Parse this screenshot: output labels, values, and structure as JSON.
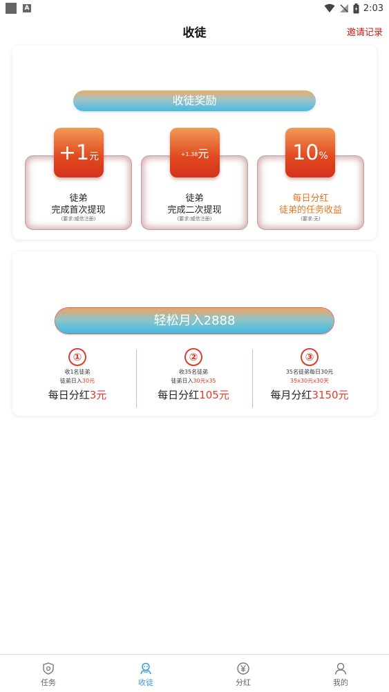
{
  "status": {
    "time": "2:03"
  },
  "header": {
    "title": "收徒",
    "invite": "邀请记录"
  },
  "rewards": {
    "banner": "收徒奖励",
    "items": [
      {
        "amount": "+1",
        "unit": "元",
        "line1": "徒弟",
        "line2": "完成首次提现",
        "req": "(要求:威信注册)"
      },
      {
        "amount": "+1.38",
        "unit": "元",
        "line1": "徒弟",
        "line2": "完成二次提现",
        "req": "(要求:威信注册)"
      },
      {
        "amount": "10",
        "unit": "%",
        "line1": "每日分红",
        "line2": "徒弟的任务收益",
        "req": "(要求:无)"
      }
    ]
  },
  "income": {
    "banner": "轻松月入2888",
    "steps": [
      {
        "num": "①",
        "l1": "收1名徒弟",
        "l2a": "徒弟日入",
        "l2b": "30元",
        "l3a": "每日分红",
        "l3b": "3元"
      },
      {
        "num": "②",
        "l1": "收35名徒弟",
        "l2a": "徒弟日入",
        "l2b": "30元x35",
        "l3a": "每日分红",
        "l3b": "105元"
      },
      {
        "num": "③",
        "l1": "35名徒弟每日30元",
        "l2a": "",
        "l2b": "35x30元x30天",
        "l3a": "每月分红",
        "l3b": "3150元"
      }
    ]
  },
  "tabs": [
    {
      "label": "任务",
      "icon": "shield-icon"
    },
    {
      "label": "收徒",
      "icon": "people-icon"
    },
    {
      "label": "分红",
      "icon": "yen-icon"
    },
    {
      "label": "我的",
      "icon": "user-icon"
    }
  ],
  "colors": {
    "accent": "#3c9be0",
    "red": "#e03a2a",
    "orange": "#e8761c"
  }
}
